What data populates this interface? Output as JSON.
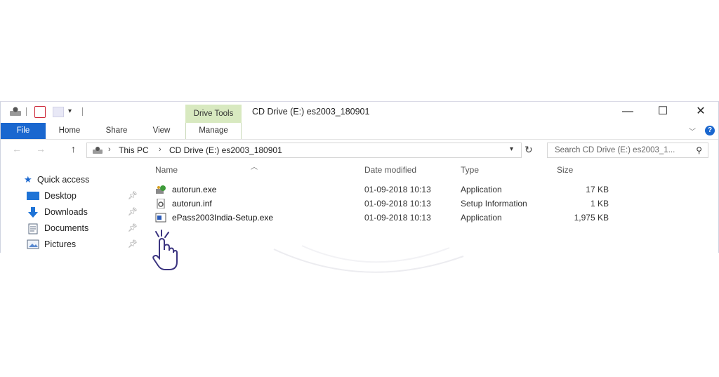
{
  "window": {
    "title": "CD Drive (E:) es2003_180901",
    "contextual_tab": "Drive Tools",
    "controls": {
      "minimize": "—",
      "maximize": "☐",
      "close": "✕"
    }
  },
  "ribbon": {
    "tabs": [
      "File",
      "Home",
      "Share",
      "View",
      "Manage"
    ],
    "help": "?"
  },
  "address": {
    "back": "←",
    "forward": "→",
    "up": "↑",
    "breadcrumb": [
      "This PC",
      "CD Drive (E:) es2003_180901"
    ],
    "search_placeholder": "Search CD Drive (E:) es2003_1..."
  },
  "nav_pane": {
    "quick_access": "Quick access",
    "items": [
      {
        "label": "Desktop",
        "icon": "desktop-icon",
        "pinned": true
      },
      {
        "label": "Downloads",
        "icon": "downloads-icon",
        "pinned": true
      },
      {
        "label": "Documents",
        "icon": "documents-icon",
        "pinned": true
      },
      {
        "label": "Pictures",
        "icon": "pictures-icon",
        "pinned": true
      }
    ]
  },
  "file_list": {
    "columns": [
      "Name",
      "Date modified",
      "Type",
      "Size"
    ],
    "rows": [
      {
        "name": "autorun.exe",
        "date": "01-09-2018 10:13",
        "type": "Application",
        "size": "17 KB",
        "icon": "installer-exe-icon"
      },
      {
        "name": "autorun.inf",
        "date": "01-09-2018 10:13",
        "type": "Setup Information",
        "size": "1 KB",
        "icon": "inf-file-icon"
      },
      {
        "name": "ePass2003India-Setup.exe",
        "date": "01-09-2018 10:13",
        "type": "Application",
        "size": "1,975 KB",
        "icon": "setup-exe-icon"
      }
    ]
  },
  "colors": {
    "file_tab": "#1a67cf",
    "drive_tools": "#d8e9c0",
    "cursor": "#3b3480"
  }
}
